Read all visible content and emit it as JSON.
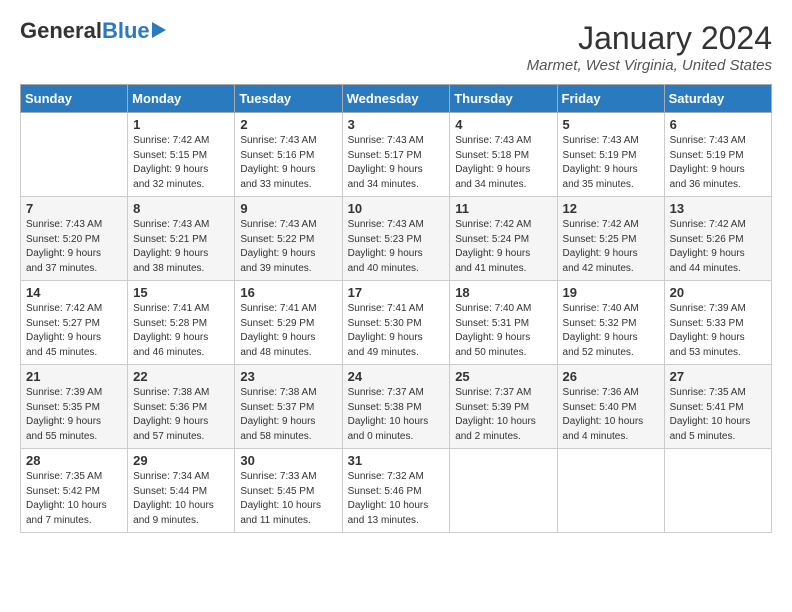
{
  "logo": {
    "general": "General",
    "blue": "Blue"
  },
  "title": "January 2024",
  "subtitle": "Marmet, West Virginia, United States",
  "days_of_week": [
    "Sunday",
    "Monday",
    "Tuesday",
    "Wednesday",
    "Thursday",
    "Friday",
    "Saturday"
  ],
  "weeks": [
    [
      {
        "day": "",
        "info": ""
      },
      {
        "day": "1",
        "info": "Sunrise: 7:42 AM\nSunset: 5:15 PM\nDaylight: 9 hours\nand 32 minutes."
      },
      {
        "day": "2",
        "info": "Sunrise: 7:43 AM\nSunset: 5:16 PM\nDaylight: 9 hours\nand 33 minutes."
      },
      {
        "day": "3",
        "info": "Sunrise: 7:43 AM\nSunset: 5:17 PM\nDaylight: 9 hours\nand 34 minutes."
      },
      {
        "day": "4",
        "info": "Sunrise: 7:43 AM\nSunset: 5:18 PM\nDaylight: 9 hours\nand 34 minutes."
      },
      {
        "day": "5",
        "info": "Sunrise: 7:43 AM\nSunset: 5:19 PM\nDaylight: 9 hours\nand 35 minutes."
      },
      {
        "day": "6",
        "info": "Sunrise: 7:43 AM\nSunset: 5:19 PM\nDaylight: 9 hours\nand 36 minutes."
      }
    ],
    [
      {
        "day": "7",
        "info": "Sunrise: 7:43 AM\nSunset: 5:20 PM\nDaylight: 9 hours\nand 37 minutes."
      },
      {
        "day": "8",
        "info": "Sunrise: 7:43 AM\nSunset: 5:21 PM\nDaylight: 9 hours\nand 38 minutes."
      },
      {
        "day": "9",
        "info": "Sunrise: 7:43 AM\nSunset: 5:22 PM\nDaylight: 9 hours\nand 39 minutes."
      },
      {
        "day": "10",
        "info": "Sunrise: 7:43 AM\nSunset: 5:23 PM\nDaylight: 9 hours\nand 40 minutes."
      },
      {
        "day": "11",
        "info": "Sunrise: 7:42 AM\nSunset: 5:24 PM\nDaylight: 9 hours\nand 41 minutes."
      },
      {
        "day": "12",
        "info": "Sunrise: 7:42 AM\nSunset: 5:25 PM\nDaylight: 9 hours\nand 42 minutes."
      },
      {
        "day": "13",
        "info": "Sunrise: 7:42 AM\nSunset: 5:26 PM\nDaylight: 9 hours\nand 44 minutes."
      }
    ],
    [
      {
        "day": "14",
        "info": "Sunrise: 7:42 AM\nSunset: 5:27 PM\nDaylight: 9 hours\nand 45 minutes."
      },
      {
        "day": "15",
        "info": "Sunrise: 7:41 AM\nSunset: 5:28 PM\nDaylight: 9 hours\nand 46 minutes."
      },
      {
        "day": "16",
        "info": "Sunrise: 7:41 AM\nSunset: 5:29 PM\nDaylight: 9 hours\nand 48 minutes."
      },
      {
        "day": "17",
        "info": "Sunrise: 7:41 AM\nSunset: 5:30 PM\nDaylight: 9 hours\nand 49 minutes."
      },
      {
        "day": "18",
        "info": "Sunrise: 7:40 AM\nSunset: 5:31 PM\nDaylight: 9 hours\nand 50 minutes."
      },
      {
        "day": "19",
        "info": "Sunrise: 7:40 AM\nSunset: 5:32 PM\nDaylight: 9 hours\nand 52 minutes."
      },
      {
        "day": "20",
        "info": "Sunrise: 7:39 AM\nSunset: 5:33 PM\nDaylight: 9 hours\nand 53 minutes."
      }
    ],
    [
      {
        "day": "21",
        "info": "Sunrise: 7:39 AM\nSunset: 5:35 PM\nDaylight: 9 hours\nand 55 minutes."
      },
      {
        "day": "22",
        "info": "Sunrise: 7:38 AM\nSunset: 5:36 PM\nDaylight: 9 hours\nand 57 minutes."
      },
      {
        "day": "23",
        "info": "Sunrise: 7:38 AM\nSunset: 5:37 PM\nDaylight: 9 hours\nand 58 minutes."
      },
      {
        "day": "24",
        "info": "Sunrise: 7:37 AM\nSunset: 5:38 PM\nDaylight: 10 hours\nand 0 minutes."
      },
      {
        "day": "25",
        "info": "Sunrise: 7:37 AM\nSunset: 5:39 PM\nDaylight: 10 hours\nand 2 minutes."
      },
      {
        "day": "26",
        "info": "Sunrise: 7:36 AM\nSunset: 5:40 PM\nDaylight: 10 hours\nand 4 minutes."
      },
      {
        "day": "27",
        "info": "Sunrise: 7:35 AM\nSunset: 5:41 PM\nDaylight: 10 hours\nand 5 minutes."
      }
    ],
    [
      {
        "day": "28",
        "info": "Sunrise: 7:35 AM\nSunset: 5:42 PM\nDaylight: 10 hours\nand 7 minutes."
      },
      {
        "day": "29",
        "info": "Sunrise: 7:34 AM\nSunset: 5:44 PM\nDaylight: 10 hours\nand 9 minutes."
      },
      {
        "day": "30",
        "info": "Sunrise: 7:33 AM\nSunset: 5:45 PM\nDaylight: 10 hours\nand 11 minutes."
      },
      {
        "day": "31",
        "info": "Sunrise: 7:32 AM\nSunset: 5:46 PM\nDaylight: 10 hours\nand 13 minutes."
      },
      {
        "day": "",
        "info": ""
      },
      {
        "day": "",
        "info": ""
      },
      {
        "day": "",
        "info": ""
      }
    ]
  ]
}
